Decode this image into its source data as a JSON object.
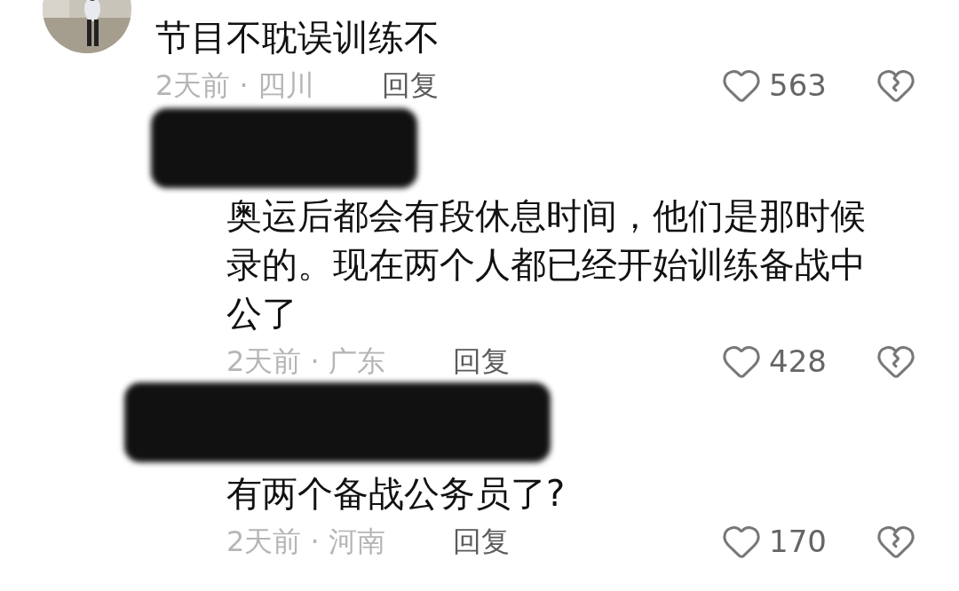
{
  "comments": [
    {
      "text": "节目不耽误训练不",
      "meta": "2天前 · 四川",
      "reply_label": "回复",
      "likes": "563",
      "replies": [
        {
          "redacted": true,
          "text": "奥运后都会有段休息时间，他们是那时候录的。现在两个人都已经开始训练备战中公了",
          "meta": "2天前 · 广东",
          "reply_label": "回复",
          "likes": "428"
        },
        {
          "redacted": true,
          "text": "有两个备战公务员了?",
          "meta": "2天前 · 河南",
          "reply_label": "回复",
          "likes": "170"
        }
      ]
    }
  ]
}
